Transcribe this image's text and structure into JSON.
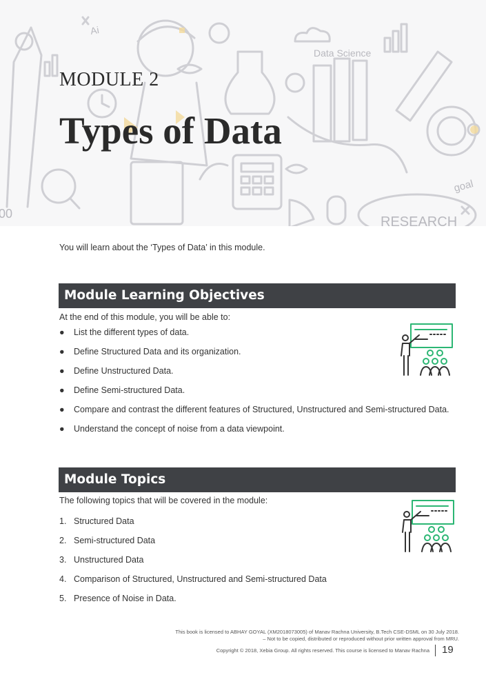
{
  "header": {
    "module_label": "MODULE 2",
    "title": "Types of Data",
    "doodle_words": [
      "Data Science",
      "Ai",
      "goal",
      "RESEARCH",
      "00"
    ]
  },
  "intro": "You will learn about the ‘Types of Data’ in this module.",
  "objectives": {
    "heading": "Module Learning Objectives",
    "lead": "At the end of this module, you will be able to:",
    "items": [
      "List the different types of data.",
      "Define Structured Data and its organization.",
      "Define Unstructured Data.",
      "Define Semi-structured Data.",
      "Compare and contrast the different features of Structured, Unstructured and Semi-structured Data.",
      "Understand the concept of noise from a data viewpoint."
    ],
    "icon": "teacher-presentation-icon"
  },
  "topics": {
    "heading": "Module Topics",
    "lead": "The following topics that will be covered in the module:",
    "items": [
      "Structured Data",
      "Semi-structured Data",
      "Unstructured Data",
      "Comparison of Structured, Unstructured and Semi-structured Data",
      "Presence of Noise in Data."
    ],
    "icon": "teacher-presentation-icon"
  },
  "footer": {
    "license_line1": "This book is licensed to ABHAY GOYAL (XM2018073005) of Manav Rachna University, B.Tech CSE-DSML on 30 July 2018.",
    "license_line2": "– Not to be copied, distributed or reproduced without prior written approval from MRU.",
    "copyright": "Copyright © 2018, Xebia Group. All rights reserved. This course is licensed to Manav Rachna",
    "page_number": "19"
  },
  "colors": {
    "section_bar": "#3f4145",
    "accent_green": "#2bb673",
    "doodle": "#cfcfd4",
    "doodle_yellow": "#f3d99b"
  }
}
